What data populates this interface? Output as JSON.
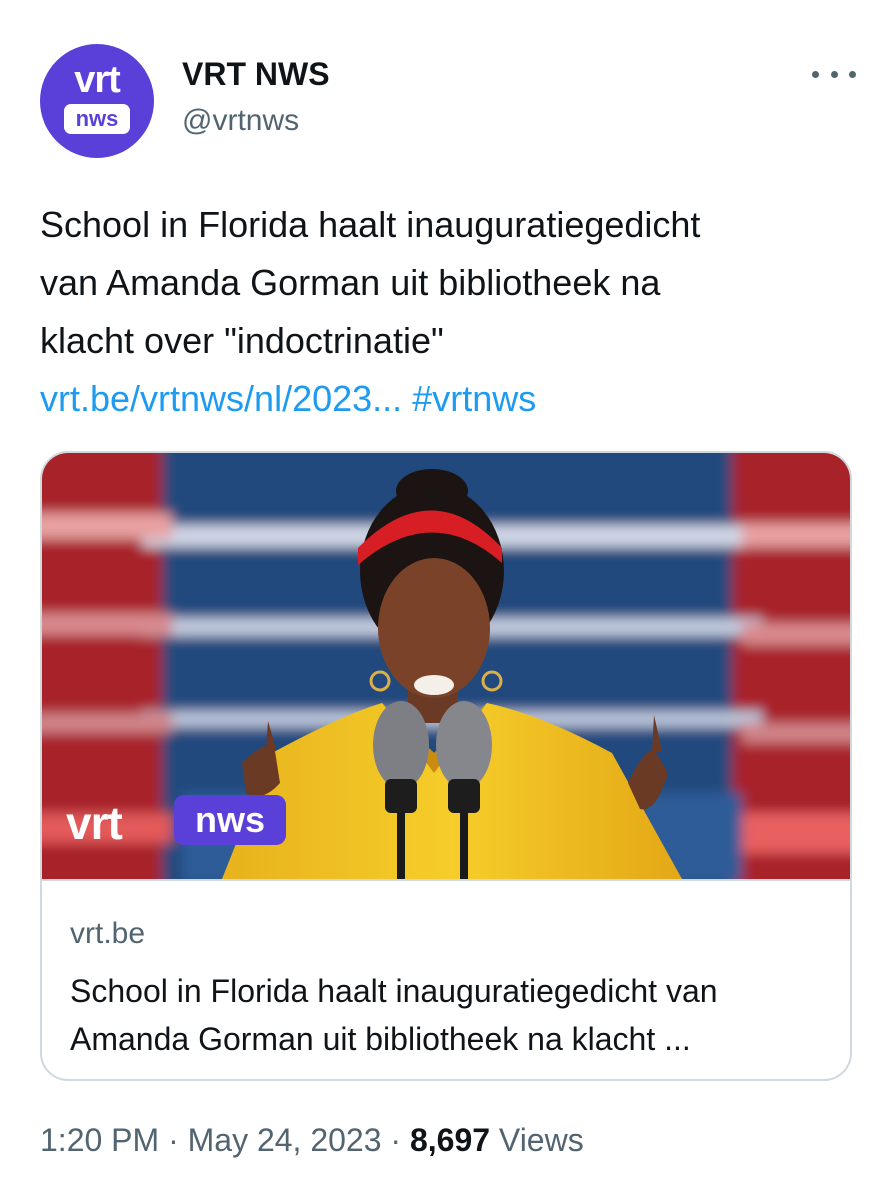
{
  "account": {
    "avatar_top": "vrt",
    "avatar_bottom": "nws",
    "display_name": "VRT NWS",
    "handle": "@vrtnws"
  },
  "menu": {
    "icon": "more-horizontal-icon"
  },
  "tweet": {
    "text_lines": [
      "School in Florida haalt inauguratiegedicht",
      "van Amanda Gorman uit bibliotheek na",
      "klacht over \"indoctrinatie\""
    ],
    "link_text": "vrt.be/vrtnws/nl/2023...",
    "hashtag": "#vrtnws"
  },
  "card": {
    "image_logo_vrt": "vrt",
    "image_logo_nws": "nws",
    "domain": "vrt.be",
    "title_lines": [
      "School in Florida haalt inauguratiegedicht van",
      "Amanda Gorman uit bibliotheek na klacht ..."
    ]
  },
  "meta": {
    "time": "1:20 PM",
    "separator": " · ",
    "date": "May 24, 2023",
    "views_count": "8,697",
    "views_label": "Views"
  },
  "colors": {
    "brand_purple": "#5b3fd9",
    "link_blue": "#1d9bf0",
    "secondary_text": "#536471",
    "border": "#cfd9de"
  }
}
